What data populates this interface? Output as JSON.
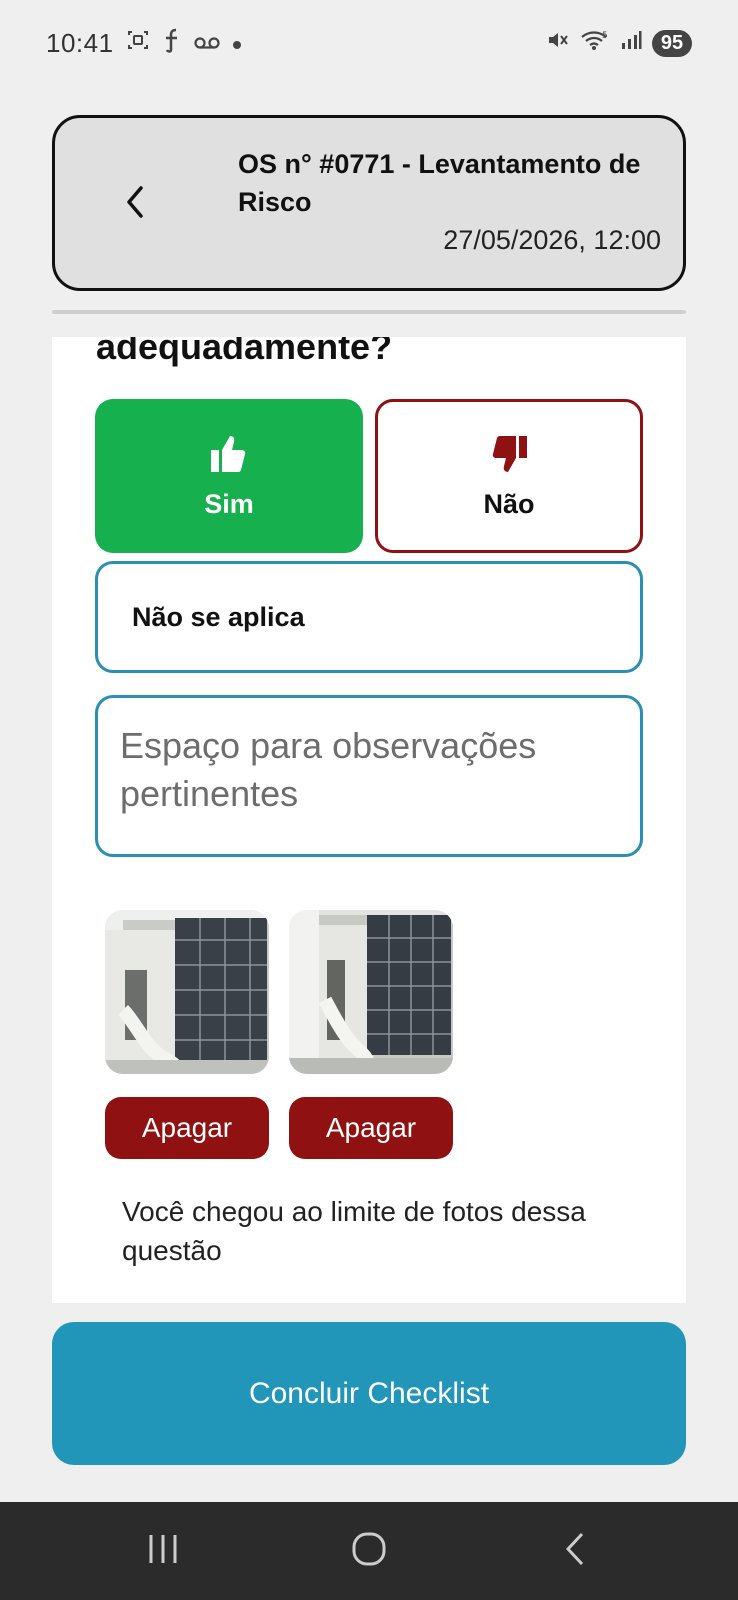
{
  "status_bar": {
    "time": "10:41",
    "battery": "95",
    "icons": [
      "screenshot-icon",
      "f-icon",
      "voicemail-icon",
      "dot-icon",
      "mute-icon",
      "wifi-icon",
      "signal-icon",
      "battery-icon"
    ]
  },
  "header": {
    "title": "OS n° #0771 - Levantamento de Risco",
    "datetime": "27/05/2026, 12:00"
  },
  "question": {
    "text_visible": "adequadamente?"
  },
  "answers": {
    "yes_label": "Sim",
    "no_label": "Não",
    "not_applicable_label": "Não se aplica",
    "selected": "Sim"
  },
  "observations": {
    "placeholder": "Espaço para observações pertinentes",
    "value": ""
  },
  "photos": {
    "items": [
      {
        "delete_label": "Apagar"
      },
      {
        "delete_label": "Apagar"
      }
    ],
    "limit_message": "Você chegou ao limite de fotos dessa questão"
  },
  "footer": {
    "conclude_label": "Concluir Checklist"
  },
  "colors": {
    "yes_green": "#17b04f",
    "no_red": "#8f1111",
    "accent_blue": "#2196b9",
    "border_blue": "#2b8fb3"
  }
}
